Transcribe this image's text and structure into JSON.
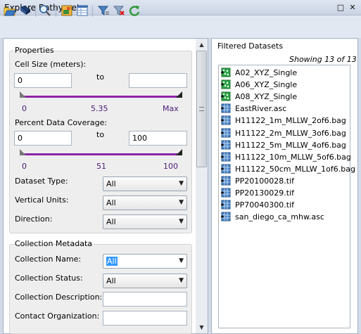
{
  "window": {
    "title": "Explore Bathymetry",
    "restore_glyph": "□",
    "close_glyph": "✕"
  },
  "toolbar": {
    "icons": [
      "open-folder-icon",
      "save-icon",
      "zoom-icon",
      "map-layer-icon",
      "table-icon",
      "filter-icon",
      "clear-filter-icon",
      "refresh-icon"
    ]
  },
  "properties": {
    "title": "Properties",
    "cell_size": {
      "label": "Cell Size (meters):",
      "min_value": "0",
      "to_label": "to",
      "max_value": "",
      "ticks": [
        "0",
        "5.35",
        "Max"
      ]
    },
    "coverage": {
      "label": "Percent Data Coverage:",
      "min_value": "0",
      "to_label": "to",
      "max_value": "100",
      "ticks": [
        "0",
        "51",
        "100"
      ]
    },
    "dataset_type": {
      "label": "Dataset Type:",
      "value": "All"
    },
    "vertical_units": {
      "label": "Vertical Units:",
      "value": "All"
    },
    "direction": {
      "label": "Direction:",
      "value": "All"
    }
  },
  "collection": {
    "title": "Collection Metadata",
    "name": {
      "label": "Collection Name:",
      "value": "All"
    },
    "status": {
      "label": "Collection Status:",
      "value": "All"
    },
    "description": {
      "label": "Collection Description:",
      "value": ""
    },
    "contact": {
      "label": "Contact Organization:",
      "value": ""
    }
  },
  "filtered": {
    "title": "Filtered Datasets",
    "showing": "Showing 13 of 13",
    "datasets": [
      {
        "name": "A02_XYZ_Single",
        "icon": "xyz-point-icon"
      },
      {
        "name": "A06_XYZ_Single",
        "icon": "xyz-point-icon"
      },
      {
        "name": "A08_XYZ_Single",
        "icon": "xyz-point-icon"
      },
      {
        "name": "EastRiver.asc",
        "icon": "raster-grid-icon"
      },
      {
        "name": "H11122_1m_MLLW_2of6.bag",
        "icon": "raster-grid-icon"
      },
      {
        "name": "H11122_2m_MLLW_3of6.bag",
        "icon": "raster-grid-icon"
      },
      {
        "name": "H11122_5m_MLLW_4of6.bag",
        "icon": "raster-grid-icon"
      },
      {
        "name": "H11122_10m_MLLW_5of6.bag",
        "icon": "raster-grid-icon"
      },
      {
        "name": "H11122_50cm_MLLW_1of6.bag",
        "icon": "raster-grid-icon"
      },
      {
        "name": "PP20100028.tif",
        "icon": "raster-grid-icon"
      },
      {
        "name": "PP20130029.tif",
        "icon": "raster-grid-icon"
      },
      {
        "name": "PP70040300.tif",
        "icon": "raster-grid-icon"
      },
      {
        "name": "san_diego_ca_mhw.asc",
        "icon": "raster-grid-icon"
      }
    ]
  },
  "colors": {
    "slider_accent": "#8e24aa",
    "xyz_icon": "#2fa64a",
    "raster_icon": "#4a86c8"
  }
}
